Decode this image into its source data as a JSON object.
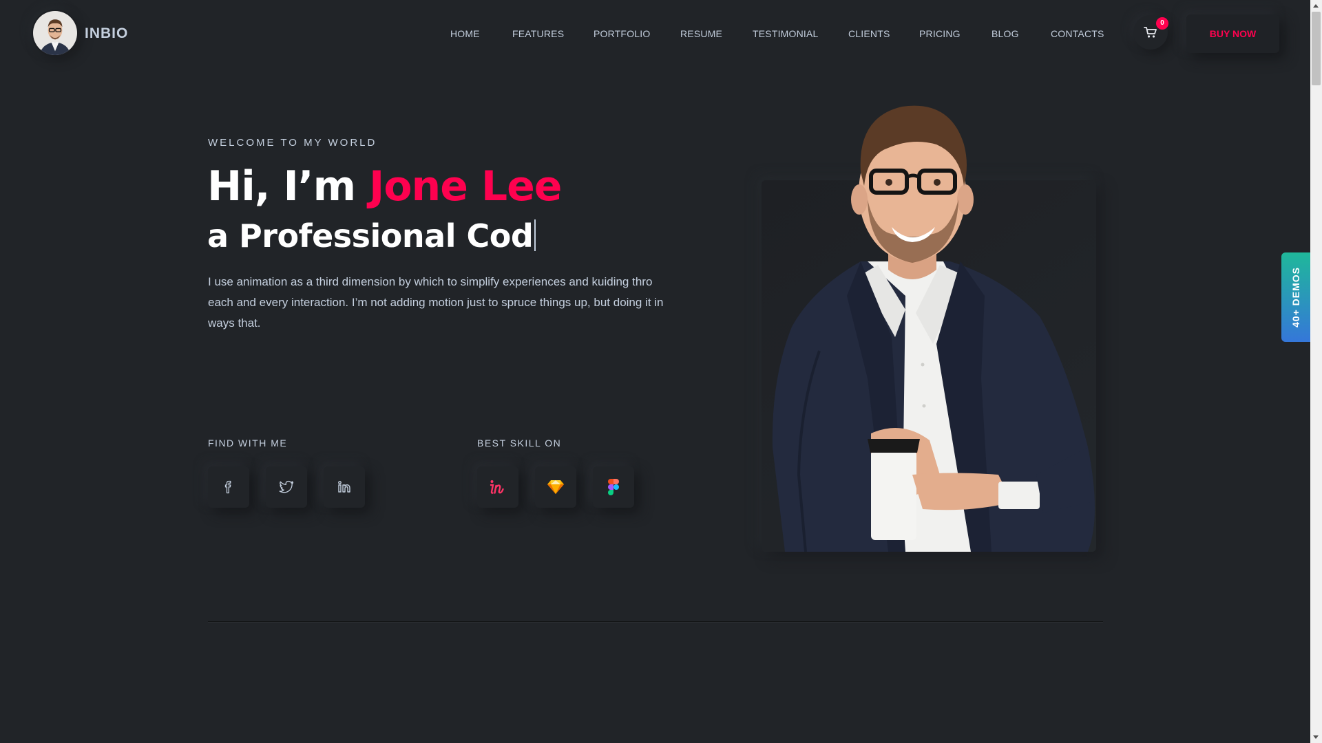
{
  "header": {
    "brand": "INBIO",
    "nav": [
      {
        "label": "HOME"
      },
      {
        "label": "FEATURES"
      },
      {
        "label": "PORTFOLIO"
      },
      {
        "label": "RESUME"
      },
      {
        "label": "TESTIMONIAL"
      },
      {
        "label": "CLIENTS"
      },
      {
        "label": "PRICING"
      },
      {
        "label": "BLOG"
      },
      {
        "label": "CONTACTS"
      }
    ],
    "cart_count": "0",
    "cart_icon": "cart-icon",
    "buy_label": "BUY NOW"
  },
  "hero": {
    "welcome": "WELCOME TO MY WORLD",
    "greeting": "Hi, I’m ",
    "name": "Jone Lee",
    "subtitle": "a Professional Cod",
    "description": "I use animation as a third dimension by which to simplify experiences and kuiding thro each and every interaction. I’m not adding motion just to spruce things up, but doing it in ways that."
  },
  "social": {
    "label": "FIND WITH ME",
    "icons": [
      "facebook-icon",
      "twitter-icon",
      "linkedin-icon"
    ]
  },
  "skills": {
    "label": "BEST SKILL ON",
    "icons": [
      "invision-icon",
      "sketch-icon",
      "figma-icon"
    ]
  },
  "demos_tab": "40+ DEMOS",
  "colors": {
    "background": "#212428",
    "accent": "#ff014f",
    "text": "#c4cfde",
    "heading": "#ffffff"
  }
}
